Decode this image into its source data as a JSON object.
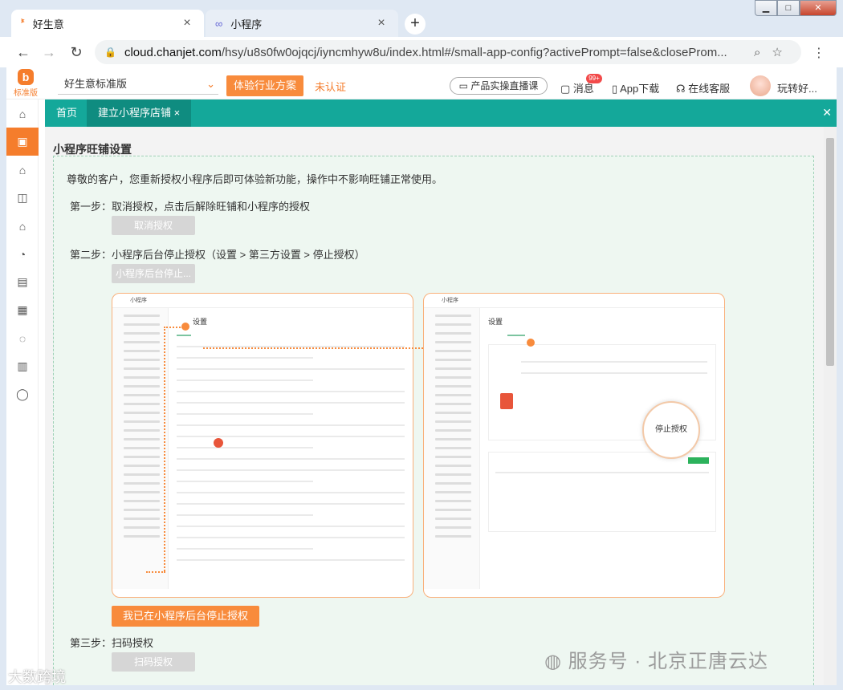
{
  "browser": {
    "tabs": [
      {
        "label": "好生意",
        "close": "×"
      },
      {
        "label": "小程序",
        "close": "×"
      }
    ],
    "new_tab": "+",
    "url_host": "cloud.chanjet.com",
    "url_path": "/hsy/u8s0fw0ojqcj/iyncmhyw8u/index.html#/small-app-config?activePrompt=false&closeProm..."
  },
  "app": {
    "logo_text": "标准版",
    "edition": "好生意标准版",
    "solution_button": "体验行业方案",
    "unverified": "未认证",
    "live_button": "产品实操直播课",
    "message_label": "消息",
    "message_badge": "99+",
    "app_download": "App下载",
    "online_service": "在线客服",
    "user_name": "玩转好..."
  },
  "tealbar": {
    "home": "首页",
    "current": "建立小程序店铺 ×"
  },
  "content": {
    "title": "小程序旺铺设置",
    "intro": "尊敬的客户，您重新授权小程序后即可体验新功能，操作中不影响旺铺正常使用。",
    "step1": "第一步：取消授权，点击后解除旺铺和小程序的授权",
    "step1_button": "取消授权",
    "step2": "第二步：小程序后台停止授权（设置 > 第三方设置 > 停止授权）",
    "step2_button": "小程序后台停止...",
    "shot_left_title": "小程序",
    "shot_left_heading": "设置",
    "shot_right_title": "小程序",
    "shot_right_heading": "设置",
    "stop_label": "停止授权",
    "confirm_button": "我已在小程序后台停止授权",
    "step3": "第三步：扫码授权",
    "step3_button": "扫码授权"
  },
  "watermarks": {
    "service": "服务号 · 北京正唐云达",
    "bigdata": "大数跨境"
  }
}
